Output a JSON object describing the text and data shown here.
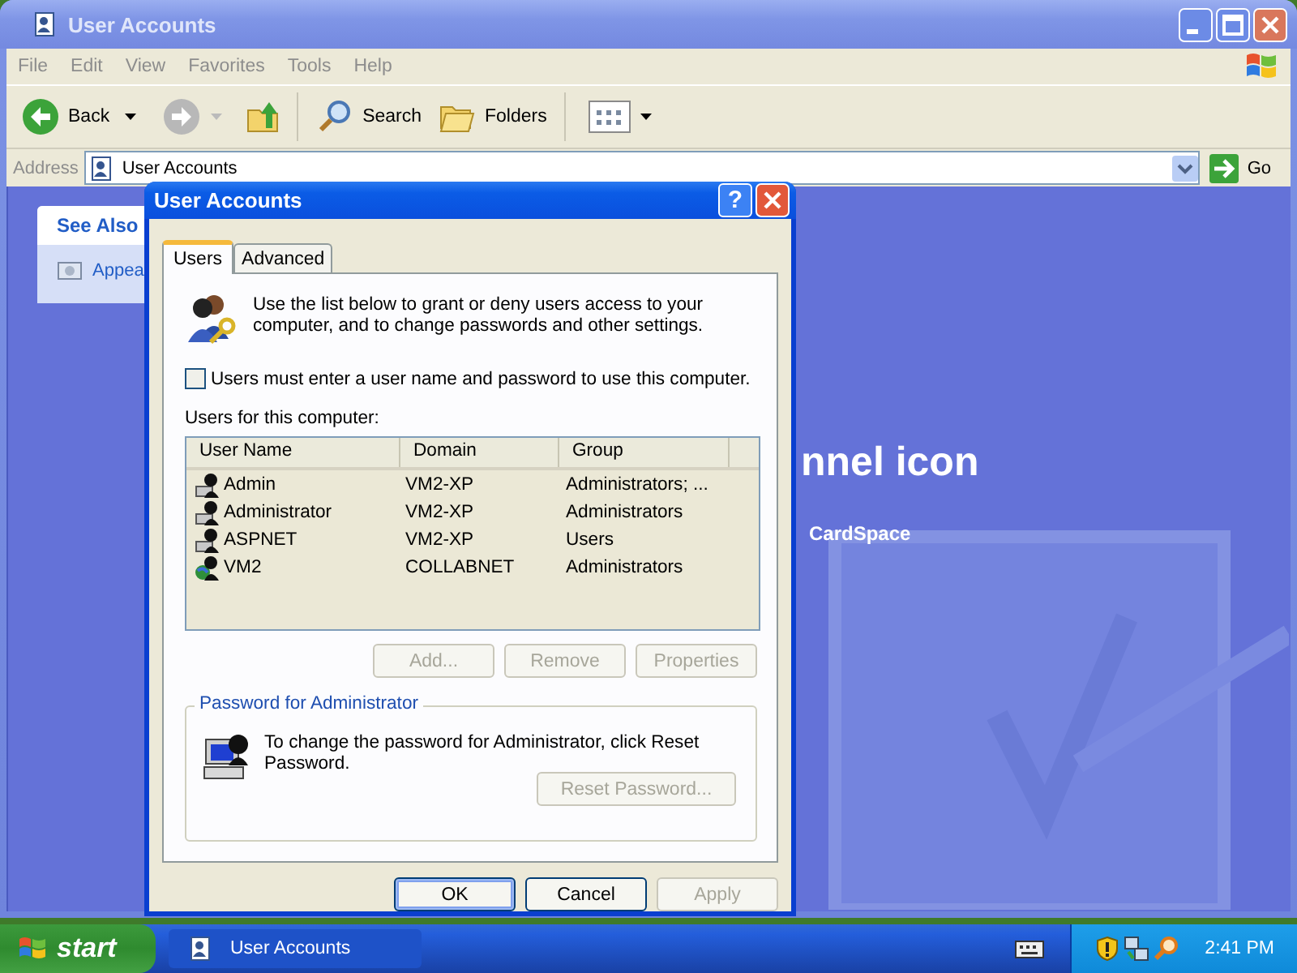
{
  "window": {
    "title": "User Accounts"
  },
  "menu": [
    "File",
    "Edit",
    "View",
    "Favorites",
    "Tools",
    "Help"
  ],
  "toolbar": {
    "back": "Back",
    "search": "Search",
    "folders": "Folders"
  },
  "address": {
    "label": "Address",
    "value": "User Accounts",
    "go": "Go"
  },
  "see_also": {
    "title": "See Also",
    "items": [
      "Appea"
    ]
  },
  "content": {
    "heading": "nnel icon",
    "link": "CardSpace"
  },
  "dialog": {
    "title": "User Accounts",
    "help": "?",
    "tabs": [
      {
        "label": "Users",
        "selected": true
      },
      {
        "label": "Advanced",
        "selected": false
      }
    ],
    "intro": "Use the list below to grant or deny users access to your computer, and to change passwords and other settings.",
    "require_password": {
      "label": "Users must enter a user name and password to use this computer.",
      "checked": false
    },
    "list_label": "Users for this computer:",
    "columns": [
      "User Name",
      "Domain",
      "Group"
    ],
    "rows": [
      {
        "name": "Admin",
        "domain": "VM2-XP",
        "group": "Administrators; ...",
        "kind": "local",
        "selected": false
      },
      {
        "name": "Administrator",
        "domain": "VM2-XP",
        "group": "Administrators",
        "kind": "local",
        "selected": false
      },
      {
        "name": "ASPNET",
        "domain": "VM2-XP",
        "group": "Users",
        "kind": "local",
        "selected": false
      },
      {
        "name": "VM2",
        "domain": "COLLABNET",
        "group": "Administrators",
        "kind": "domain",
        "selected": false
      }
    ],
    "list_buttons": [
      {
        "label": "Add...",
        "disabled": true
      },
      {
        "label": "Remove",
        "disabled": true
      },
      {
        "label": "Properties",
        "disabled": true
      }
    ],
    "password_group": {
      "title": "Password for Administrator",
      "text": "To change the password for Administrator, click Reset Password.",
      "button": {
        "label": "Reset Password...",
        "disabled": true
      }
    },
    "buttons": [
      {
        "label": "OK",
        "disabled": false,
        "default": true
      },
      {
        "label": "Cancel",
        "disabled": false,
        "default": false
      },
      {
        "label": "Apply",
        "disabled": true,
        "default": false
      }
    ]
  },
  "taskbar": {
    "start": "start",
    "tasks": [
      {
        "label": "User Accounts"
      }
    ],
    "clock": "2:41 PM"
  }
}
